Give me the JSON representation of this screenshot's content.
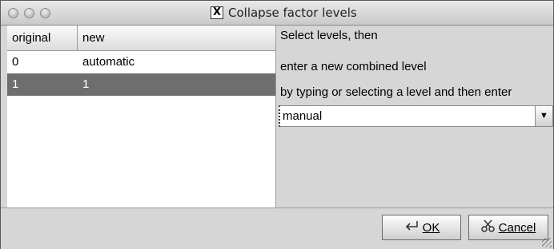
{
  "window": {
    "title": "Collapse factor levels",
    "title_icon": "x-window-icon"
  },
  "table": {
    "columns": [
      "original",
      "new"
    ],
    "rows": [
      {
        "original": "0",
        "new": "automatic",
        "selected": false
      },
      {
        "original": "1",
        "new": "1",
        "selected": true
      }
    ]
  },
  "panel": {
    "instruction_1": "Select levels, then",
    "instruction_2": "enter a new combined level",
    "instruction_3": "by typing or selecting a level and then enter",
    "combo_value": "manual"
  },
  "buttons": {
    "ok_label": "OK",
    "cancel_label": "Cancel"
  },
  "colors": {
    "selected_row_bg": "#6e6e6e",
    "window_bg": "#d6d6d6"
  }
}
